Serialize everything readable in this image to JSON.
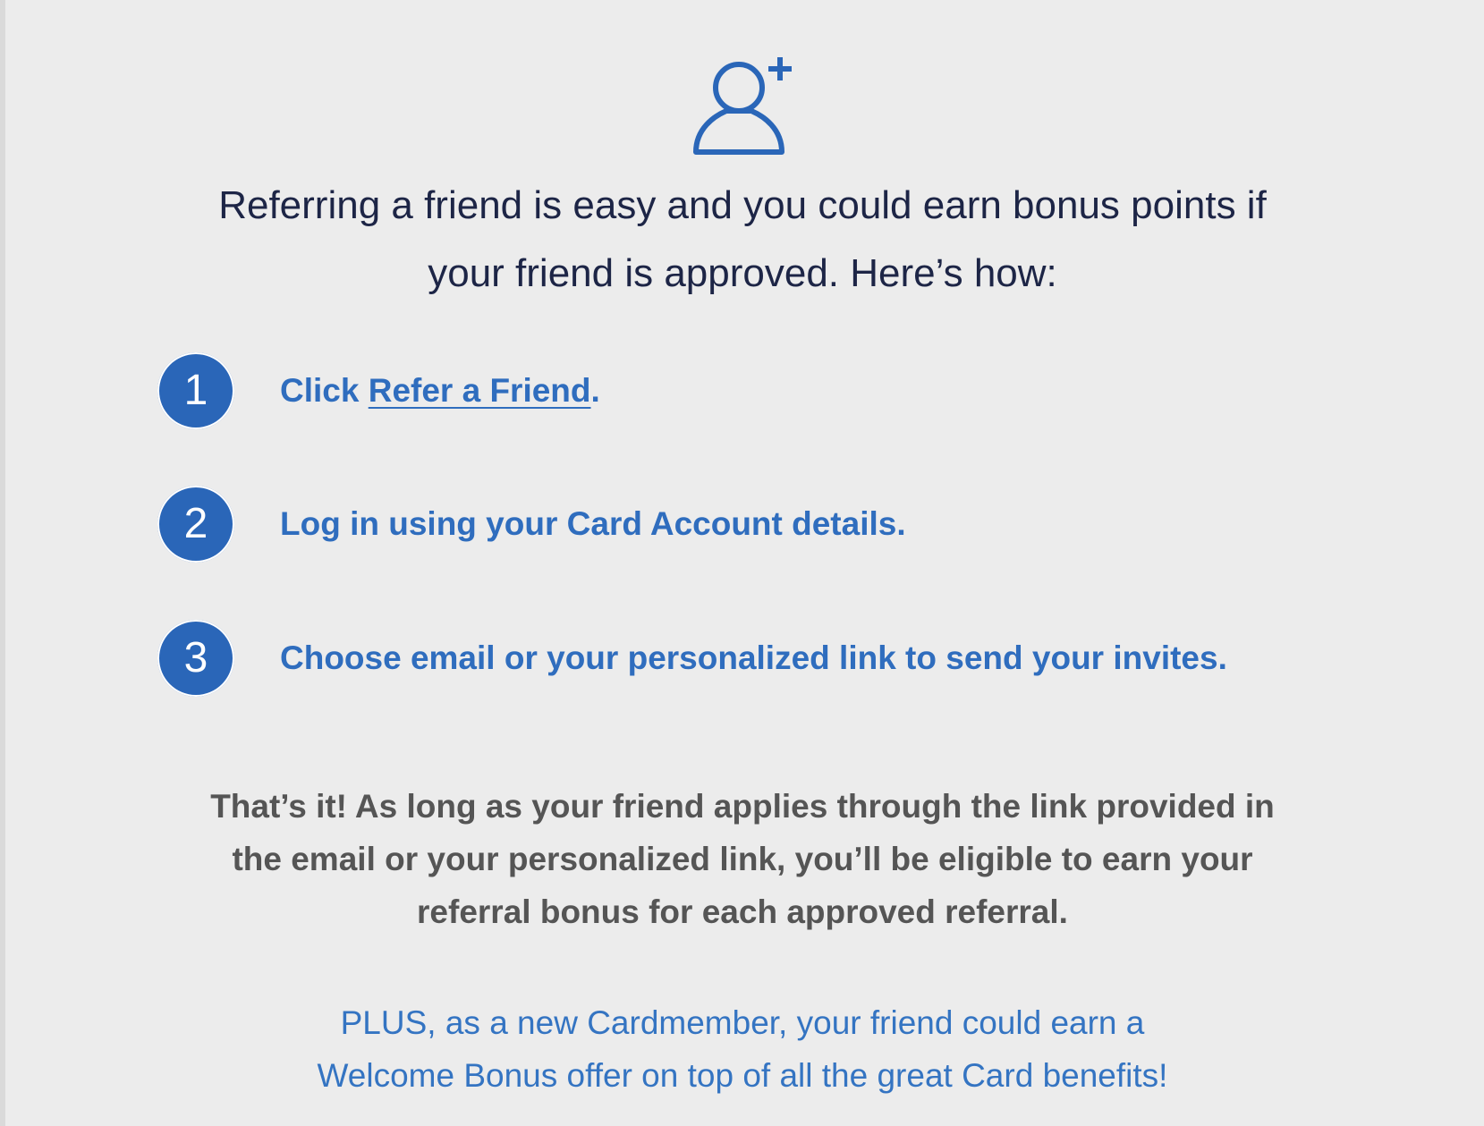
{
  "icon": "add-user-icon",
  "colors": {
    "background": "#ececec",
    "accent": "#2a66b8",
    "step_text": "#2f6dbe",
    "intro_text": "#1d2546",
    "outro_text": "#555555"
  },
  "intro": {
    "line1": "Referring a friend is easy and you could earn bonus points if",
    "line2": "your friend is approved. Here’s how:"
  },
  "steps": [
    {
      "number": "1",
      "prefix": "Click ",
      "link": "Refer a Friend",
      "suffix": "."
    },
    {
      "number": "2",
      "text": "Log in using your Card Account details."
    },
    {
      "number": "3",
      "text": "Choose email or your personalized link to send your invites."
    }
  ],
  "outro": {
    "line1": "That’s it! As long as your friend applies through the link provided in",
    "line2": "the email or your personalized link, you’ll be eligible to earn your",
    "line3": "referral bonus for each approved referral."
  },
  "plus": {
    "line1": "PLUS, as a new Cardmember, your friend could earn a",
    "line2": "Welcome Bonus offer on top of all the great Card benefits!"
  }
}
